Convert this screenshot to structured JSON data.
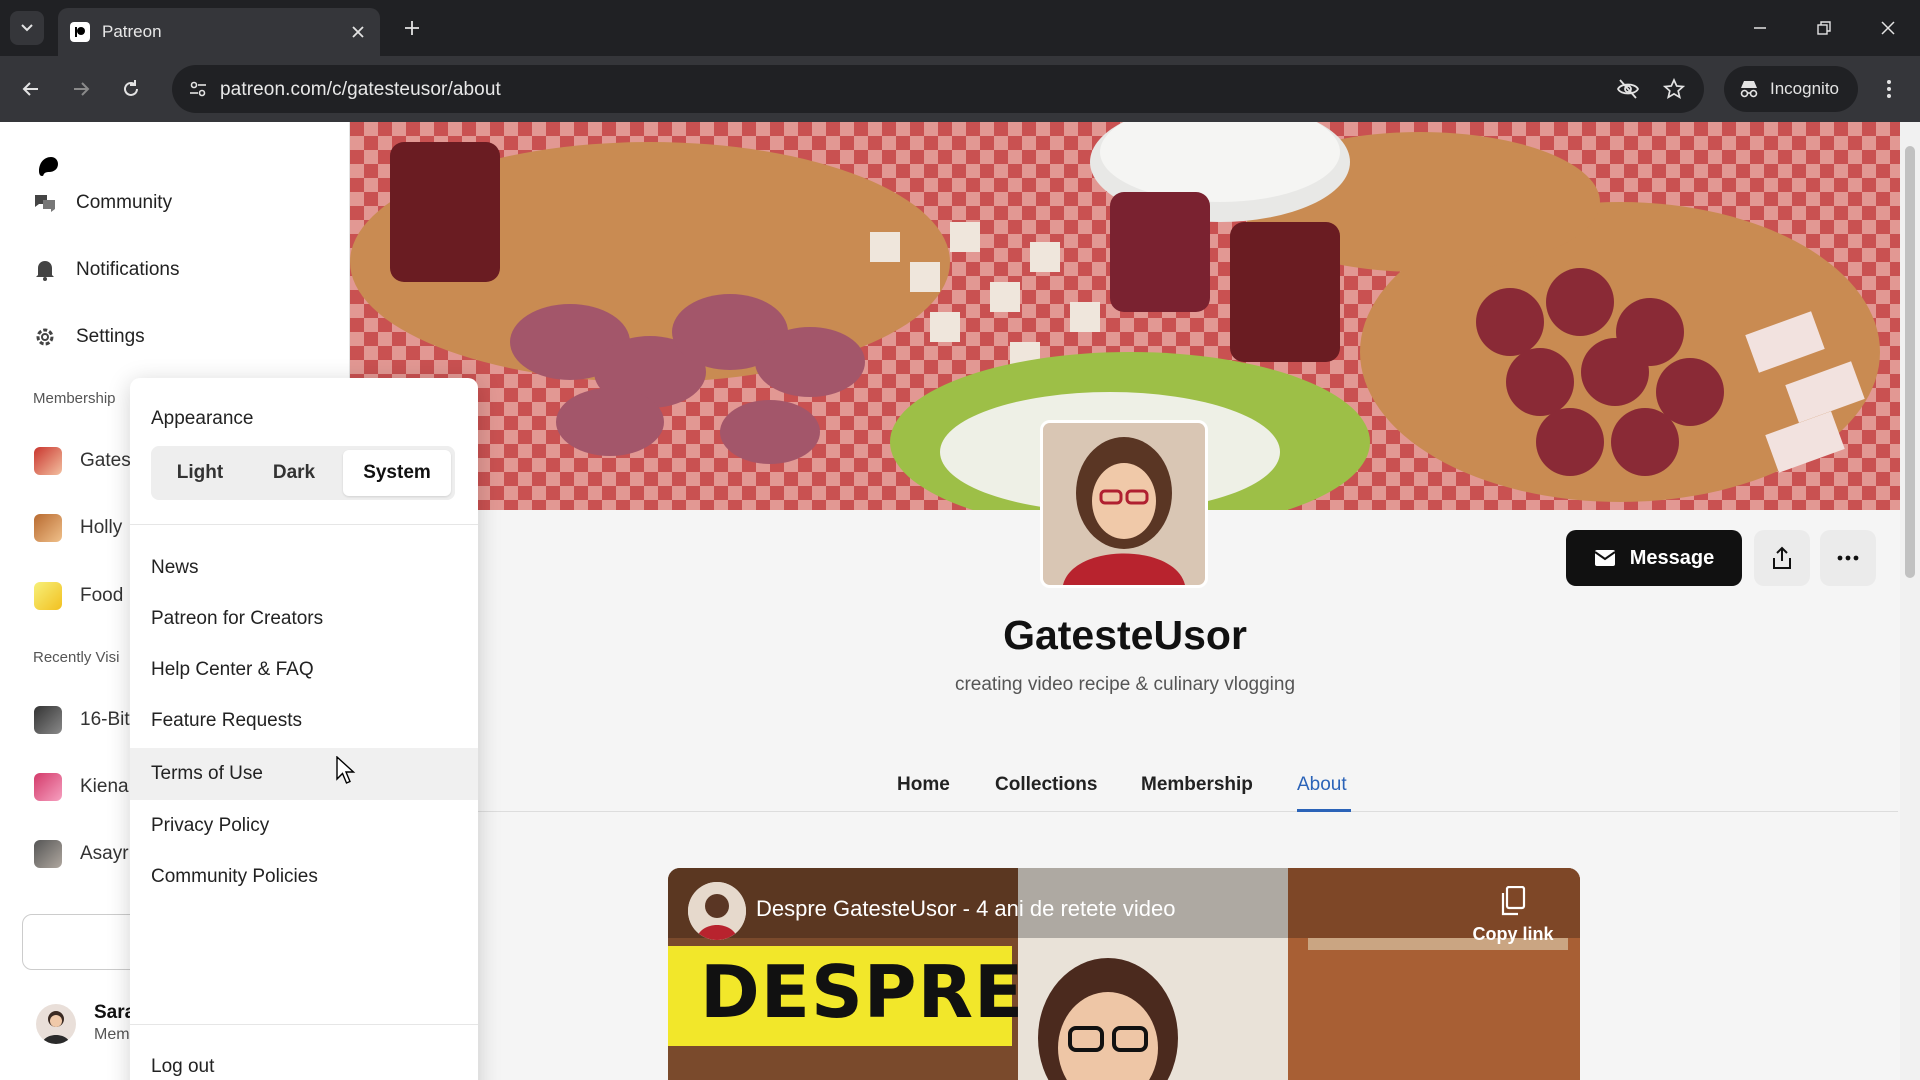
{
  "browser": {
    "tab_title": "Patreon",
    "url": "patreon.com/c/gatesteusor/about",
    "incognito_label": "Incognito"
  },
  "sidebar": {
    "nav": [
      {
        "label": "Community",
        "icon": "community-icon"
      },
      {
        "label": "Notifications",
        "icon": "bell-icon"
      },
      {
        "label": "Settings",
        "icon": "gear-icon"
      }
    ],
    "memberships_label": "Membership",
    "memberships": [
      "Gates",
      "Holly",
      "Food"
    ],
    "recent_label": "Recently Visi",
    "recent": [
      "16-Bit",
      "Kiena",
      "Asayr"
    ],
    "user": {
      "name": "Sarah",
      "role": "Member"
    }
  },
  "menu": {
    "appearance_label": "Appearance",
    "appearance_options": [
      "Light",
      "Dark",
      "System"
    ],
    "appearance_selected": "System",
    "items": [
      "News",
      "Patreon for Creators",
      "Help Center & FAQ",
      "Feature Requests",
      "Terms of Use",
      "Privacy Policy",
      "Community Policies"
    ],
    "hovered_item": "Terms of Use",
    "logout_label": "Log out"
  },
  "creator": {
    "name": "GatesteUsor",
    "tagline": "creating video recipe & culinary vlogging",
    "message_label": "Message"
  },
  "tabs": [
    "Home",
    "Collections",
    "Membership",
    "About"
  ],
  "active_tab": "About",
  "video": {
    "title": "Despre GatesteUsor - 4 ani de retete video",
    "overlay_word": "DESPRE",
    "copy_link_label": "Copy link"
  },
  "colors": {
    "accent": "#2b63b8",
    "dark_button": "#111111",
    "chrome_bg": "#202124"
  }
}
